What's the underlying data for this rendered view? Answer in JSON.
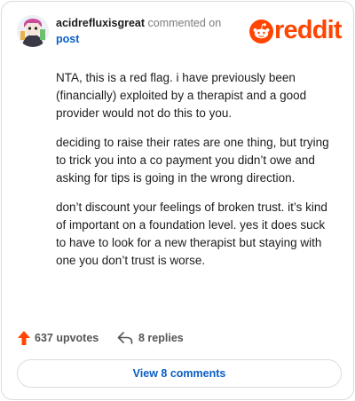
{
  "comment": {
    "username": "acidrefluxisgreat",
    "commented_on": "commented on",
    "post_link": "post",
    "brand": "reddit",
    "paragraphs": [
      "NTA, this is a red flag. i have previously been (financially) exploited by a therapist and a good provider would not do this to you.",
      "deciding to raise their rates are one thing, but trying to trick you into a co payment you didn’t owe and asking for tips is going in the wrong direction.",
      "don’t discount your feelings of broken trust. it’s kind of important on a foundation level. yes it does suck to have to look for a new therapist but staying with one you don’t trust is worse."
    ]
  },
  "actions": {
    "upvotes": "637 upvotes",
    "replies": "8 replies"
  },
  "view_button": "View 8 comments",
  "colors": {
    "brand": "#ff4500",
    "link": "#0a5ec7",
    "upvote": "#ff4500"
  }
}
